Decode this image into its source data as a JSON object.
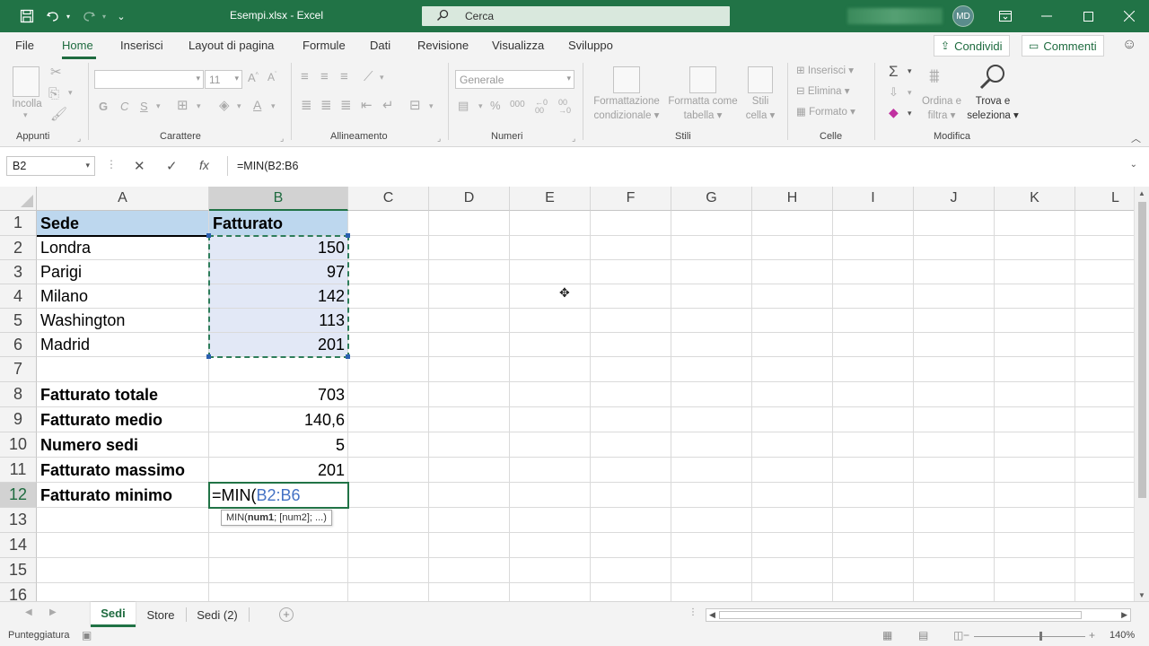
{
  "titlebar": {
    "title": "Esempi.xlsx  -  Excel",
    "search_placeholder": "Cerca",
    "user_initials": "MD",
    "save_icon": "save-icon",
    "undo_icon": "undo-icon",
    "redo_icon": "redo-icon"
  },
  "menu": {
    "file": "File",
    "home": "Home",
    "insert": "Inserisci",
    "layout": "Layout di pagina",
    "formulas": "Formule",
    "data": "Dati",
    "review": "Revisione",
    "view": "Visualizza",
    "developer": "Sviluppo",
    "share": "Condividi",
    "comments": "Commenti"
  },
  "ribbon": {
    "clipboard": {
      "label": "Appunti",
      "paste": "Incolla"
    },
    "font": {
      "label": "Carattere",
      "font_name": "",
      "font_size": "11",
      "bold": "G",
      "italic": "C",
      "underline": "S"
    },
    "alignment": {
      "label": "Allineamento"
    },
    "number": {
      "label": "Numeri",
      "format": "Generale"
    },
    "styles": {
      "label": "Stili",
      "conditional_1": "Formattazione",
      "conditional_2": "condizionale",
      "table_1": "Formatta come",
      "table_2": "tabella",
      "cell_styles_1": "Stili",
      "cell_styles_2": "cella"
    },
    "cells": {
      "label": "Celle",
      "insert": "Inserisci",
      "delete": "Elimina",
      "format": "Formato"
    },
    "editing": {
      "label": "Modifica",
      "sort_1": "Ordina e",
      "sort_2": "filtra",
      "find_1": "Trova e",
      "find_2": "seleziona"
    }
  },
  "formula_bar": {
    "name_box": "B2",
    "formula": "=MIN(B2:B6"
  },
  "sheet": {
    "columns": [
      "A",
      "B",
      "C",
      "D",
      "E",
      "F",
      "G",
      "H",
      "I",
      "J",
      "K",
      "L"
    ],
    "rows": [
      "1",
      "2",
      "3",
      "4",
      "5",
      "6",
      "7",
      "8",
      "9",
      "10",
      "11",
      "12",
      "13",
      "14",
      "15",
      "16"
    ],
    "header_a": "Sede",
    "header_b": "Fatturato",
    "data": [
      {
        "city": "Londra",
        "value": "150"
      },
      {
        "city": "Parigi",
        "value": "97"
      },
      {
        "city": "Milano",
        "value": "142"
      },
      {
        "city": "Washington",
        "value": "113"
      },
      {
        "city": "Madrid",
        "value": "201"
      }
    ],
    "summary": [
      {
        "label": "Fatturato totale",
        "value": "703"
      },
      {
        "label": "Fatturato medio",
        "value": "140,6"
      },
      {
        "label": "Numero sedi",
        "value": "5"
      },
      {
        "label": "Fatturato massimo",
        "value": "201"
      }
    ],
    "edit_label": "Fatturato minimo",
    "edit_prefix": "=MIN(",
    "edit_ref": "B2:B6",
    "tooltip_fn": "MIN(",
    "tooltip_arg1": "num1",
    "tooltip_rest": "; [num2]; ...)"
  },
  "tabs": {
    "sheets": [
      "Sedi",
      "Store",
      "Sedi (2)"
    ]
  },
  "statusbar": {
    "mode": "Punteggiatura",
    "zoom": "140%"
  },
  "colors": {
    "excel_green": "#217346",
    "header_fill": "#bdd7ee",
    "selection_fill": "#e2e8f6",
    "reference_blue": "#4472c4"
  }
}
